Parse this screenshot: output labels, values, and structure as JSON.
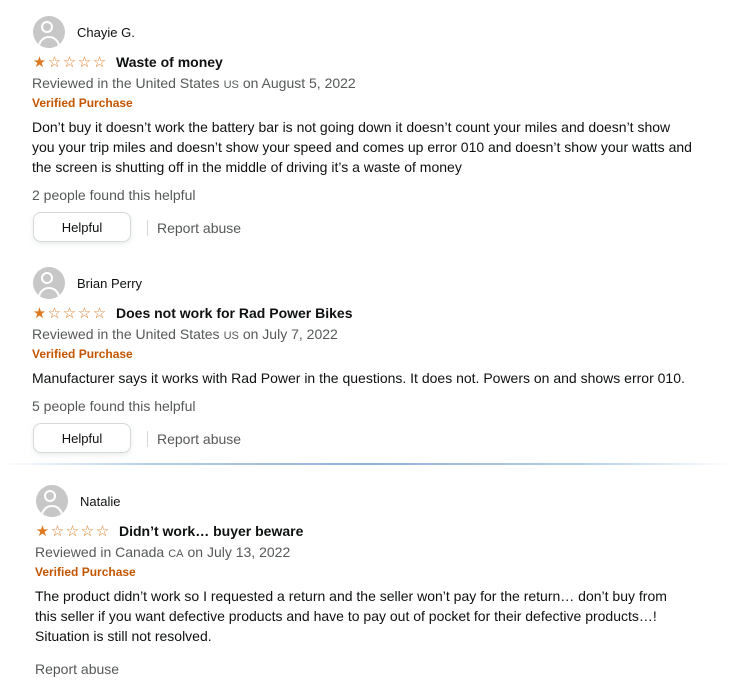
{
  "reviews": [
    {
      "reviewer": "Chayie G.",
      "rating": 1,
      "rating_max": 5,
      "title": "Waste of money",
      "meta_prefix": "Reviewed in the United States",
      "country_code": "US",
      "meta_date": "on August 5, 2022",
      "verified": "Verified Purchase",
      "lines": [
        "Don’t buy it doesn’t work the battery bar is not going down it doesn’t count your miles and doesn’t show",
        "you your trip miles and doesn’t show your speed and comes up error 010 and doesn’t show your watts and",
        "the screen is shutting off in the middle of driving it’s a waste of money"
      ],
      "helpful_count": "2 people found this helpful",
      "helpful_label": "Helpful",
      "report_label": "Report abuse"
    },
    {
      "reviewer": "Brian Perry",
      "rating": 1,
      "rating_max": 5,
      "title": "Does not work for Rad Power Bikes",
      "meta_prefix": "Reviewed in the United States",
      "country_code": "US",
      "meta_date": "on July 7, 2022",
      "verified": "Verified Purchase",
      "lines": [
        "Manufacturer says it works with Rad Power in the questions. It does not. Powers on and shows error 010."
      ],
      "helpful_count": "5 people found this helpful",
      "helpful_label": "Helpful",
      "report_label": "Report abuse"
    },
    {
      "reviewer": "Natalie",
      "rating": 1,
      "rating_max": 5,
      "title": "Didn’t work… buyer beware",
      "meta_prefix": "Reviewed in Canada",
      "country_code": "CA",
      "meta_date": "on July 13, 2022",
      "verified": "Verified Purchase",
      "lines": [
        "The product didn’t work so I requested a return and the seller won’t pay for the return… don’t buy from",
        "this seller if you want defective products and have to pay out of pocket for their defective products…!",
        "Situation is still not resolved."
      ],
      "report_label": "Report abuse"
    }
  ],
  "colors": {
    "star": "#de7921",
    "verified": "#c45500",
    "secondary_text": "#565959"
  }
}
